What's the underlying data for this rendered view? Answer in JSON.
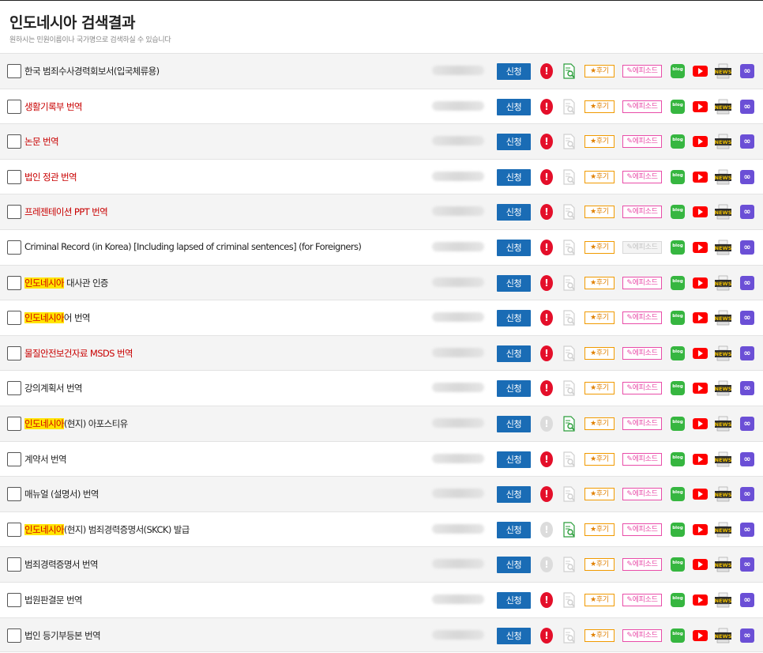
{
  "header": {
    "title": "인도네시아 검색결과",
    "subtitle": "원하시는 민원이름이나 국가명으로 검색하실 수 있습니다"
  },
  "labels": {
    "apply": "신청",
    "review": "★후기",
    "episode": "✎에피소드",
    "blog": "blog",
    "news": "NEWS",
    "warn": "!",
    "link": "∞"
  },
  "highlight_term": "인도네시아",
  "colors": {
    "apply_button": "#1a6cb5",
    "warning": "#e40f2a",
    "red_text": "#c80000",
    "highlight": "#ffe400",
    "blog": "#36b640",
    "youtube": "#ff0000",
    "link": "#6b4fd6"
  },
  "items": [
    {
      "name": "한국 범죄수사경력회보서(입국체류용)",
      "red": false,
      "warn_active": true,
      "doc_active": true,
      "episode_active": true
    },
    {
      "name": "생활기록부 번역",
      "red": true,
      "warn_active": true,
      "doc_active": false,
      "episode_active": true
    },
    {
      "name": "논문 번역",
      "red": true,
      "warn_active": true,
      "doc_active": false,
      "episode_active": true
    },
    {
      "name": "법인 정관 번역",
      "red": true,
      "warn_active": true,
      "doc_active": false,
      "episode_active": true
    },
    {
      "name": "프레젠테이션 PPT 번역",
      "red": true,
      "warn_active": true,
      "doc_active": false,
      "episode_active": true
    },
    {
      "name": "Criminal Record (in Korea) [Including lapsed of criminal sentences] (for Foreigners)",
      "red": false,
      "warn_active": true,
      "doc_active": false,
      "episode_active": false
    },
    {
      "name_highlight": "인도네시아",
      "name_rest": " 대사관 인증",
      "red": false,
      "warn_active": true,
      "doc_active": false,
      "episode_active": true
    },
    {
      "name_highlight": "인도네시아",
      "name_rest": "어 번역",
      "red": false,
      "warn_active": true,
      "doc_active": false,
      "episode_active": true
    },
    {
      "name": "물질안전보건자료 MSDS 번역",
      "red": true,
      "warn_active": true,
      "doc_active": false,
      "episode_active": true
    },
    {
      "name": "강의계획서 번역",
      "red": false,
      "warn_active": true,
      "doc_active": false,
      "episode_active": true
    },
    {
      "name_highlight": "인도네시아",
      "name_rest": "(현지) 아포스티유",
      "red": false,
      "warn_active": false,
      "doc_active": true,
      "episode_active": true
    },
    {
      "name": "계약서 번역",
      "red": false,
      "warn_active": true,
      "doc_active": false,
      "episode_active": true
    },
    {
      "name": "매뉴얼 (설명서) 번역",
      "red": false,
      "warn_active": true,
      "doc_active": false,
      "episode_active": true
    },
    {
      "name_highlight": "인도네시아",
      "name_rest": "(현지) 범죄경력증명서(SKCK) 발급",
      "red": false,
      "warn_active": false,
      "doc_active": true,
      "episode_active": true
    },
    {
      "name": "범죄경력증명서 번역",
      "red": false,
      "warn_active": false,
      "doc_active": false,
      "episode_active": true
    },
    {
      "name": "법원판결문 번역",
      "red": false,
      "warn_active": true,
      "doc_active": false,
      "episode_active": true
    },
    {
      "name": "법인 등기부등본 번역",
      "red": false,
      "warn_active": true,
      "doc_active": false,
      "episode_active": true
    }
  ]
}
